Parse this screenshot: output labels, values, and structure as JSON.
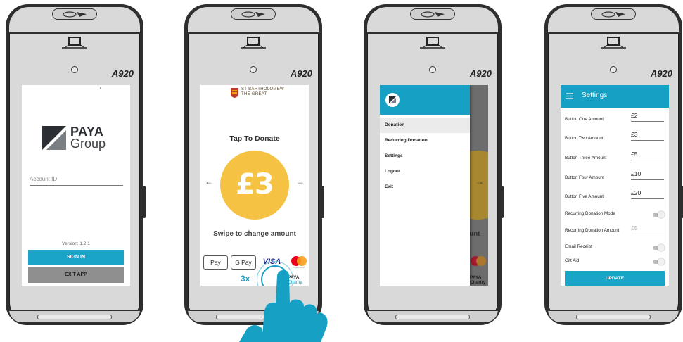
{
  "device": {
    "model": "A920"
  },
  "login": {
    "logo_word1": "PAYA",
    "logo_word2": "Group",
    "account_placeholder": "Account ID",
    "version": "Version: 1.2.1",
    "sign_in_label": "SIGN IN",
    "exit_label": "EXIT APP"
  },
  "donate": {
    "church_line1": "ST BARTHOLOMEW",
    "church_line2": "THE GREAT",
    "tap_text": "Tap To Donate",
    "amount": "£3",
    "left_arrow": "←",
    "right_arrow": "→",
    "swipe_text": "Swipe to change amount",
    "payment_methods": [
      "Pay",
      "G Pay",
      "VISA"
    ],
    "mastercard_label": "mastercard",
    "tap_count": "3x",
    "charity_line1": "PAYA",
    "charity_line2": "Charity"
  },
  "menu": {
    "items": [
      "Donation",
      "Recurring Donation",
      "Settings",
      "Logout",
      "Exit"
    ],
    "active_item": "Donation",
    "behind_text": "unt",
    "behind_charity1": "PAYA",
    "behind_charity2": "Charity"
  },
  "settings": {
    "title": "Settings",
    "rows": [
      {
        "label": "Button One Amount",
        "value": "£2"
      },
      {
        "label": "Button Two Amount",
        "value": "£3"
      },
      {
        "label": "Button Three Amount",
        "value": "£5"
      },
      {
        "label": "Button Four Amount",
        "value": "£10"
      },
      {
        "label": "Button Five Amount",
        "value": "£20"
      }
    ],
    "recurring_mode_label": "Recurring Donation Mode",
    "recurring_amount_label": "Recurring Donation Amount",
    "recurring_amount_value": "£5",
    "email_receipt_label": "Email Receipt",
    "gift_aid_label": "Gift Aid",
    "update_label": "UPDATE"
  },
  "colors": {
    "accent": "#16a0c4",
    "coin": "#f6c244",
    "exit_button": "#8f8f8f"
  }
}
